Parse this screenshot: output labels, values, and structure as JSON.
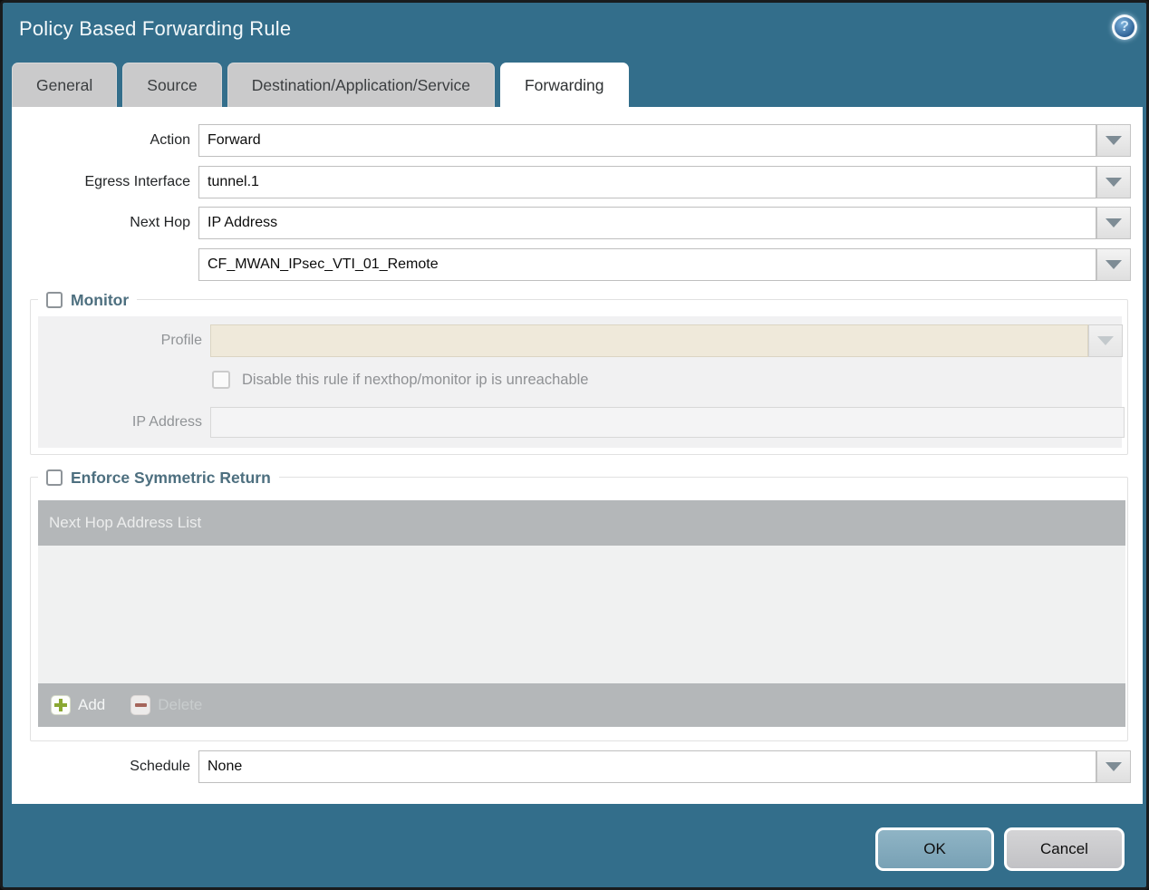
{
  "dialog": {
    "title": "Policy Based Forwarding Rule",
    "help_glyph": "?"
  },
  "tabs": [
    {
      "label": "General"
    },
    {
      "label": "Source"
    },
    {
      "label": "Destination/Application/Service"
    },
    {
      "label": "Forwarding"
    }
  ],
  "active_tab": "Forwarding",
  "form": {
    "action": {
      "label": "Action",
      "value": "Forward"
    },
    "egress_interface": {
      "label": "Egress Interface",
      "value": "tunnel.1"
    },
    "next_hop": {
      "label": "Next Hop",
      "value": "IP Address"
    },
    "next_hop_address": {
      "value": "CF_MWAN_IPsec_VTI_01_Remote"
    },
    "schedule": {
      "label": "Schedule",
      "value": "None"
    }
  },
  "monitor": {
    "legend": "Monitor",
    "checked": false,
    "profile": {
      "label": "Profile",
      "value": ""
    },
    "disable_rule_checkbox": {
      "label": "Disable this rule if nexthop/monitor ip is unreachable",
      "checked": false
    },
    "ip_address": {
      "label": "IP Address",
      "value": ""
    }
  },
  "symmetric_return": {
    "legend": "Enforce Symmetric Return",
    "checked": false,
    "table_header": "Next Hop Address List",
    "rows": [],
    "add_label": "Add",
    "delete_label": "Delete",
    "delete_enabled": false
  },
  "footer": {
    "ok_label": "OK",
    "cancel_label": "Cancel"
  },
  "colors": {
    "dialog_teal": "#336E8B",
    "tab_inactive": "#CACACB",
    "active_tab": "#FFFFFF",
    "table_header_gray": "#B4B7B9",
    "table_body_gray": "#F0F1F1",
    "profile_field_cream": "#EFE9DA",
    "legend_text": "#4D6F7F",
    "ok_button": "#84ADC0",
    "cancel_button": "#CACACD",
    "add_plus_green": "#8AA832",
    "delete_minus_red": "#A5655B",
    "help_icon_blue": "#2C5F93"
  }
}
